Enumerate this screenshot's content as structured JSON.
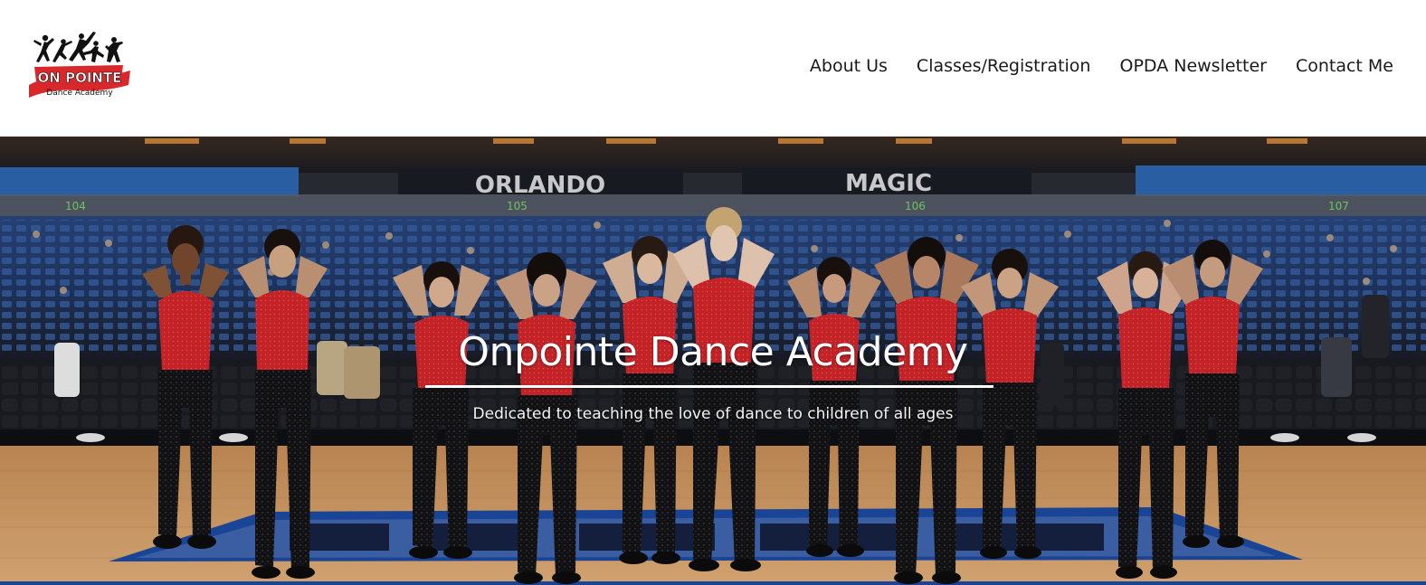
{
  "logo": {
    "name": "ON POINTE",
    "tagline": "Dance Academy"
  },
  "nav": {
    "items": [
      {
        "label": "About Us"
      },
      {
        "label": "Classes/Registration"
      },
      {
        "label": "OPDA Newsletter"
      },
      {
        "label": "Contact Me"
      }
    ]
  },
  "hero": {
    "title": "Onpointe Dance Academy",
    "subtitle": "Dedicated to teaching the love of dance to children of all ages",
    "arena_signs": [
      "ORLANDO",
      "MAGIC"
    ],
    "section_numbers": [
      "104",
      "105",
      "106",
      "107"
    ]
  },
  "colors": {
    "costume_red": "#d8282c",
    "pants_black": "#121214",
    "seats_blue": "#2d4f8c",
    "court_wood": "#d6a167",
    "court_logo_blue": "#1f4aa0"
  }
}
